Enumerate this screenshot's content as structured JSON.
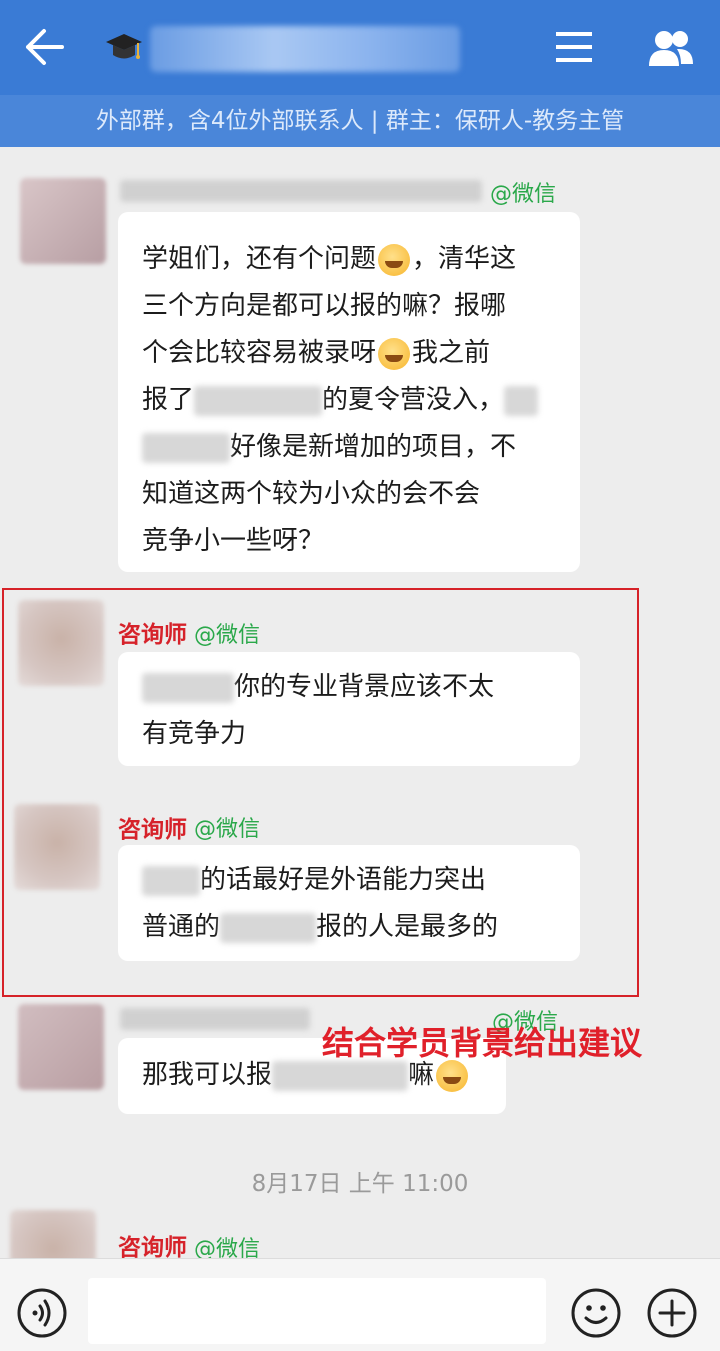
{
  "header": {
    "back_icon": "back-arrow-icon",
    "group_icon": "graduation-cap-icon",
    "menu_icon": "menu-icon",
    "members_icon": "group-members-icon",
    "subtitle": "外部群，含4位外部联系人 | 群主：保研人-教务主管"
  },
  "messages": {
    "m1": {
      "source": "@微信",
      "lines": [
        "学姐们，还有个问题",
        "，清华这",
        "三个方向是都可以报的嘛？报哪",
        "个会比较容易被录呀",
        "我之前",
        "报了",
        "的夏令营没入，",
        "好像是新增加的项目，不",
        "知道这两个较为小众的会不会",
        "竞争小一些呀？"
      ]
    },
    "m2": {
      "sender": "咨询师",
      "source": "@微信",
      "lines": [
        "你的专业背景应该不太",
        "有竞争力"
      ]
    },
    "m3": {
      "sender": "咨询师",
      "source": "@微信",
      "lines": [
        "的话最好是外语能力突出",
        "普通的",
        "报的人是最多的"
      ]
    },
    "m4": {
      "source": "@微信",
      "lines": [
        "那我可以报",
        "嘛"
      ]
    },
    "m5": {
      "sender": "咨询师",
      "source": "@微信"
    }
  },
  "annotation": "结合学员背景给出建议",
  "timestamp": "8月17日  上午 11:00",
  "bottom_bar": {
    "voice_icon": "voice-input-icon",
    "emoji_icon": "emoji-icon",
    "plus_icon": "add-more-icon"
  },
  "colors": {
    "header_bg": "#3a7bd5",
    "subheader_bg": "#4a86d9",
    "chat_bg": "#ededed",
    "wechat_tag": "#2aa84a",
    "consultant_name": "#d6222a",
    "highlight_border": "#d62228"
  }
}
